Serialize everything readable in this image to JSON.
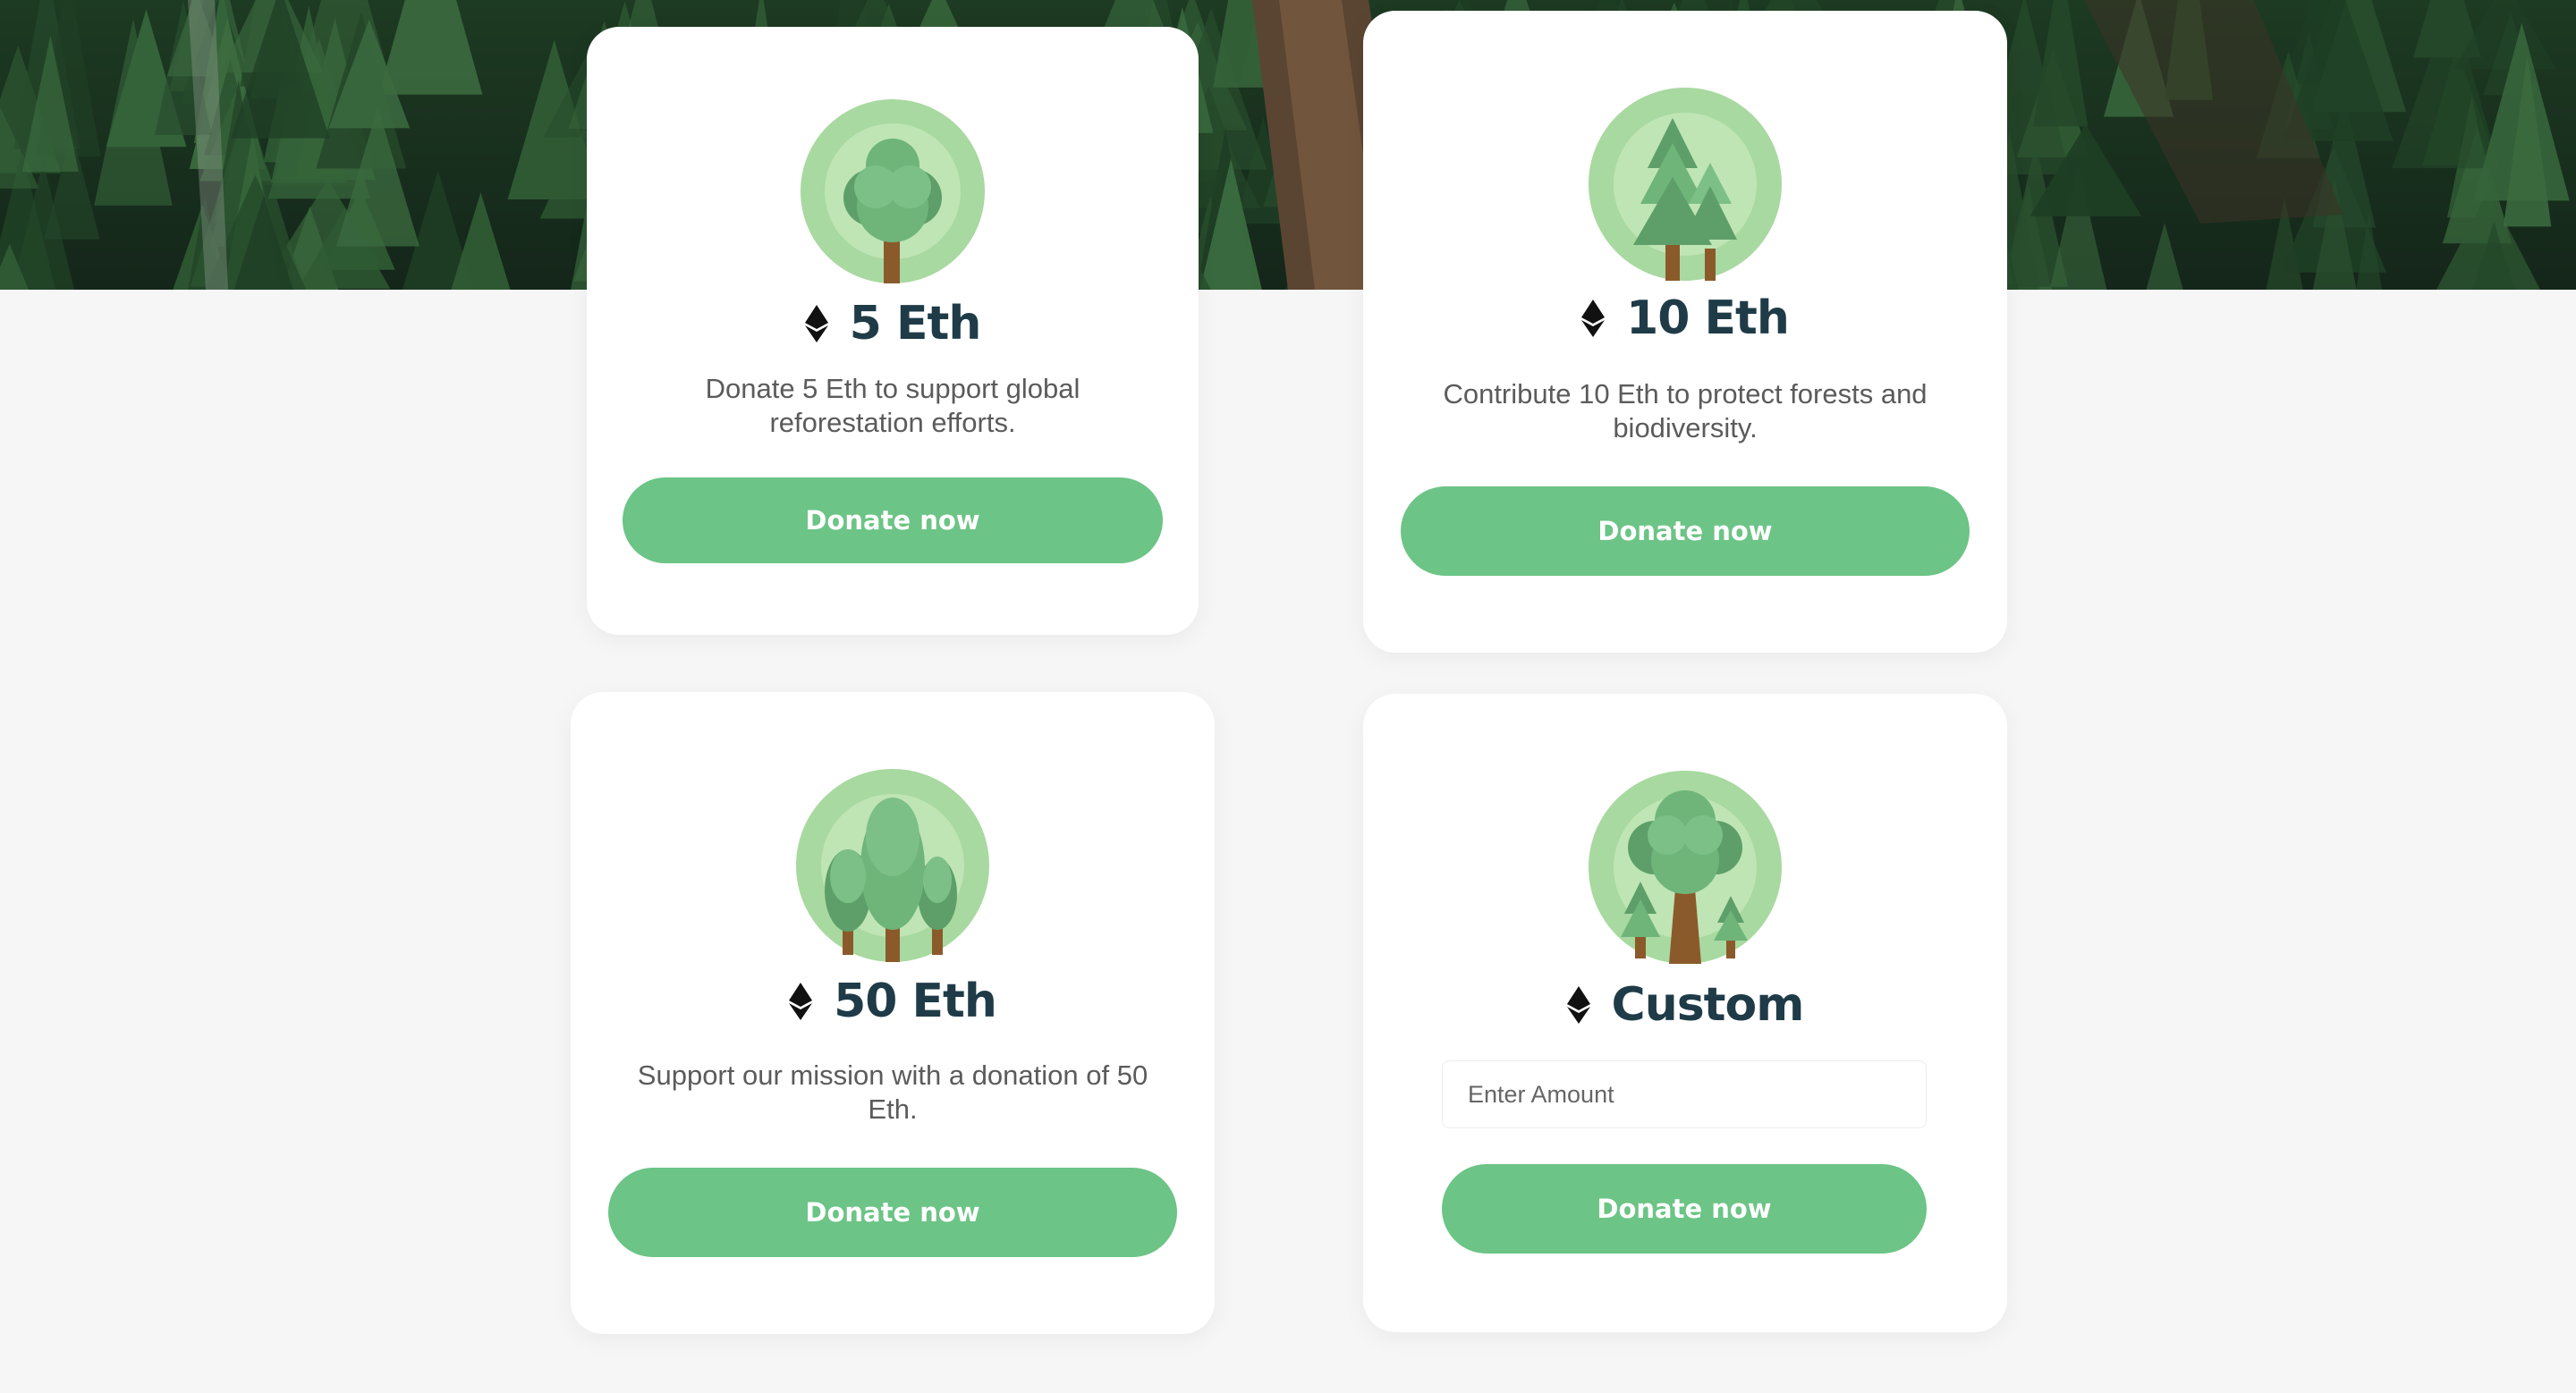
{
  "hero": {
    "image": "aerial-forest-photo"
  },
  "colors": {
    "accent": "#6cc486",
    "title": "#1f3b48",
    "text": "#5b5b5b",
    "background": "#f6f6f6"
  },
  "cards": [
    {
      "icon": "single-tree-icon",
      "currency_icon": "ethereum-icon",
      "amount": "5 Eth",
      "description_lines": [
        "Donate 5 Eth to support global",
        "reforestation efforts."
      ],
      "button_label": "Donate now"
    },
    {
      "icon": "pine-trees-icon",
      "currency_icon": "ethereum-icon",
      "amount": "10 Eth",
      "description_lines": [
        "Contribute 10 Eth to protect forests and",
        "biodiversity."
      ],
      "button_label": "Donate now"
    },
    {
      "icon": "three-trees-icon",
      "currency_icon": "ethereum-icon",
      "amount": "50 Eth",
      "description_lines": [
        "Support our mission with a donation of 50",
        "Eth."
      ],
      "button_label": "Donate now"
    },
    {
      "icon": "big-tree-icon",
      "currency_icon": "ethereum-icon",
      "amount": "Custom",
      "input": {
        "placeholder": "Enter Amount",
        "value": ""
      },
      "button_label": "Donate now"
    }
  ]
}
